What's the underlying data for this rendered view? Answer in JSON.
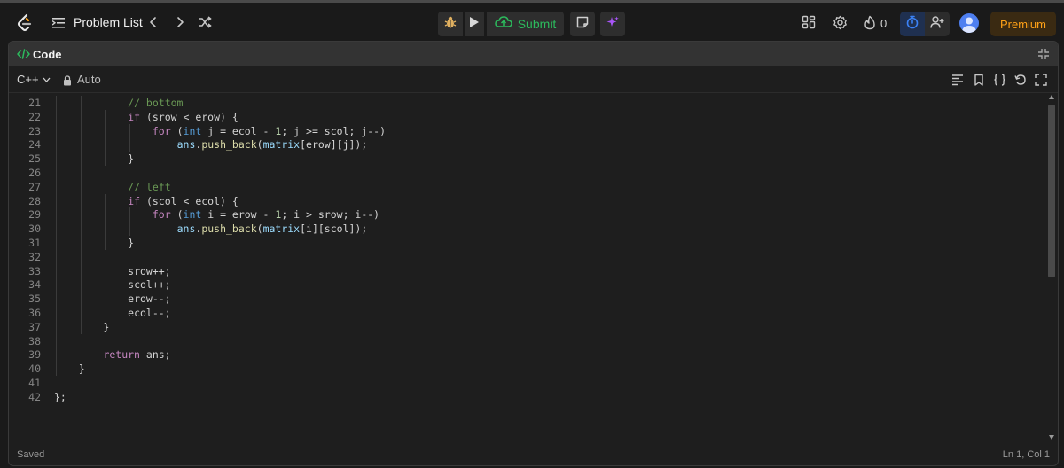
{
  "topbar": {
    "problem_list_label": "Problem List",
    "submit_label": "Submit",
    "streak_count": "0",
    "premium_label": "Premium"
  },
  "panel": {
    "tab_label": "Code"
  },
  "toolbar": {
    "language": "C++",
    "mode": "Auto"
  },
  "code": {
    "lines": [
      {
        "n": "21",
        "indent": 3,
        "tokens": [
          [
            "c",
            "// bottom"
          ]
        ]
      },
      {
        "n": "22",
        "indent": 3,
        "tokens": [
          [
            "k",
            "if"
          ],
          [
            "p",
            " (srow < erow) {"
          ]
        ]
      },
      {
        "n": "23",
        "indent": 4,
        "tokens": [
          [
            "k",
            "for"
          ],
          [
            "p",
            " ("
          ],
          [
            "t",
            "int"
          ],
          [
            "p",
            " j = ecol - "
          ],
          [
            "num",
            "1"
          ],
          [
            "p",
            "; j >= scol; j--)"
          ]
        ]
      },
      {
        "n": "24",
        "indent": 5,
        "tokens": [
          [
            "v",
            "ans"
          ],
          [
            "p",
            "."
          ],
          [
            "f",
            "push_back"
          ],
          [
            "p",
            "("
          ],
          [
            "v",
            "matrix"
          ],
          [
            "p",
            "[erow][j]);"
          ]
        ]
      },
      {
        "n": "25",
        "indent": 3,
        "tokens": [
          [
            "p",
            "}"
          ]
        ]
      },
      {
        "n": "26",
        "indent": 0,
        "tokens": []
      },
      {
        "n": "27",
        "indent": 3,
        "tokens": [
          [
            "c",
            "// left"
          ]
        ]
      },
      {
        "n": "28",
        "indent": 3,
        "tokens": [
          [
            "k",
            "if"
          ],
          [
            "p",
            " (scol < ecol) {"
          ]
        ]
      },
      {
        "n": "29",
        "indent": 4,
        "tokens": [
          [
            "k",
            "for"
          ],
          [
            "p",
            " ("
          ],
          [
            "t",
            "int"
          ],
          [
            "p",
            " i = erow - "
          ],
          [
            "num",
            "1"
          ],
          [
            "p",
            "; i > srow; i--)"
          ]
        ]
      },
      {
        "n": "30",
        "indent": 5,
        "tokens": [
          [
            "v",
            "ans"
          ],
          [
            "p",
            "."
          ],
          [
            "f",
            "push_back"
          ],
          [
            "p",
            "("
          ],
          [
            "v",
            "matrix"
          ],
          [
            "p",
            "[i][scol]);"
          ]
        ]
      },
      {
        "n": "31",
        "indent": 3,
        "tokens": [
          [
            "p",
            "}"
          ]
        ]
      },
      {
        "n": "32",
        "indent": 0,
        "tokens": []
      },
      {
        "n": "33",
        "indent": 3,
        "tokens": [
          [
            "p",
            "srow++;"
          ]
        ]
      },
      {
        "n": "34",
        "indent": 3,
        "tokens": [
          [
            "p",
            "scol++;"
          ]
        ]
      },
      {
        "n": "35",
        "indent": 3,
        "tokens": [
          [
            "p",
            "erow--;"
          ]
        ]
      },
      {
        "n": "36",
        "indent": 3,
        "tokens": [
          [
            "p",
            "ecol--;"
          ]
        ]
      },
      {
        "n": "37",
        "indent": 2,
        "tokens": [
          [
            "p",
            "}"
          ]
        ]
      },
      {
        "n": "38",
        "indent": 0,
        "tokens": []
      },
      {
        "n": "39",
        "indent": 2,
        "tokens": [
          [
            "k",
            "return"
          ],
          [
            "p",
            " ans;"
          ]
        ]
      },
      {
        "n": "40",
        "indent": 1,
        "tokens": [
          [
            "p",
            "}"
          ]
        ]
      },
      {
        "n": "41",
        "indent": 0,
        "tokens": []
      },
      {
        "n": "42",
        "indent": 0,
        "tokens": [
          [
            "p",
            "};"
          ]
        ]
      }
    ]
  },
  "status": {
    "saved": "Saved",
    "cursor": "Ln 1, Col 1"
  },
  "colors": {
    "accent_orange": "#ffa116",
    "submit_green": "#2cbb5d",
    "keyword": "#c586c0",
    "type": "#569cd6",
    "comment": "#6a9955",
    "function": "#dcdcaa",
    "variable": "#9cdcfe",
    "number": "#b5cea8",
    "plain": "#d4d4d4"
  }
}
